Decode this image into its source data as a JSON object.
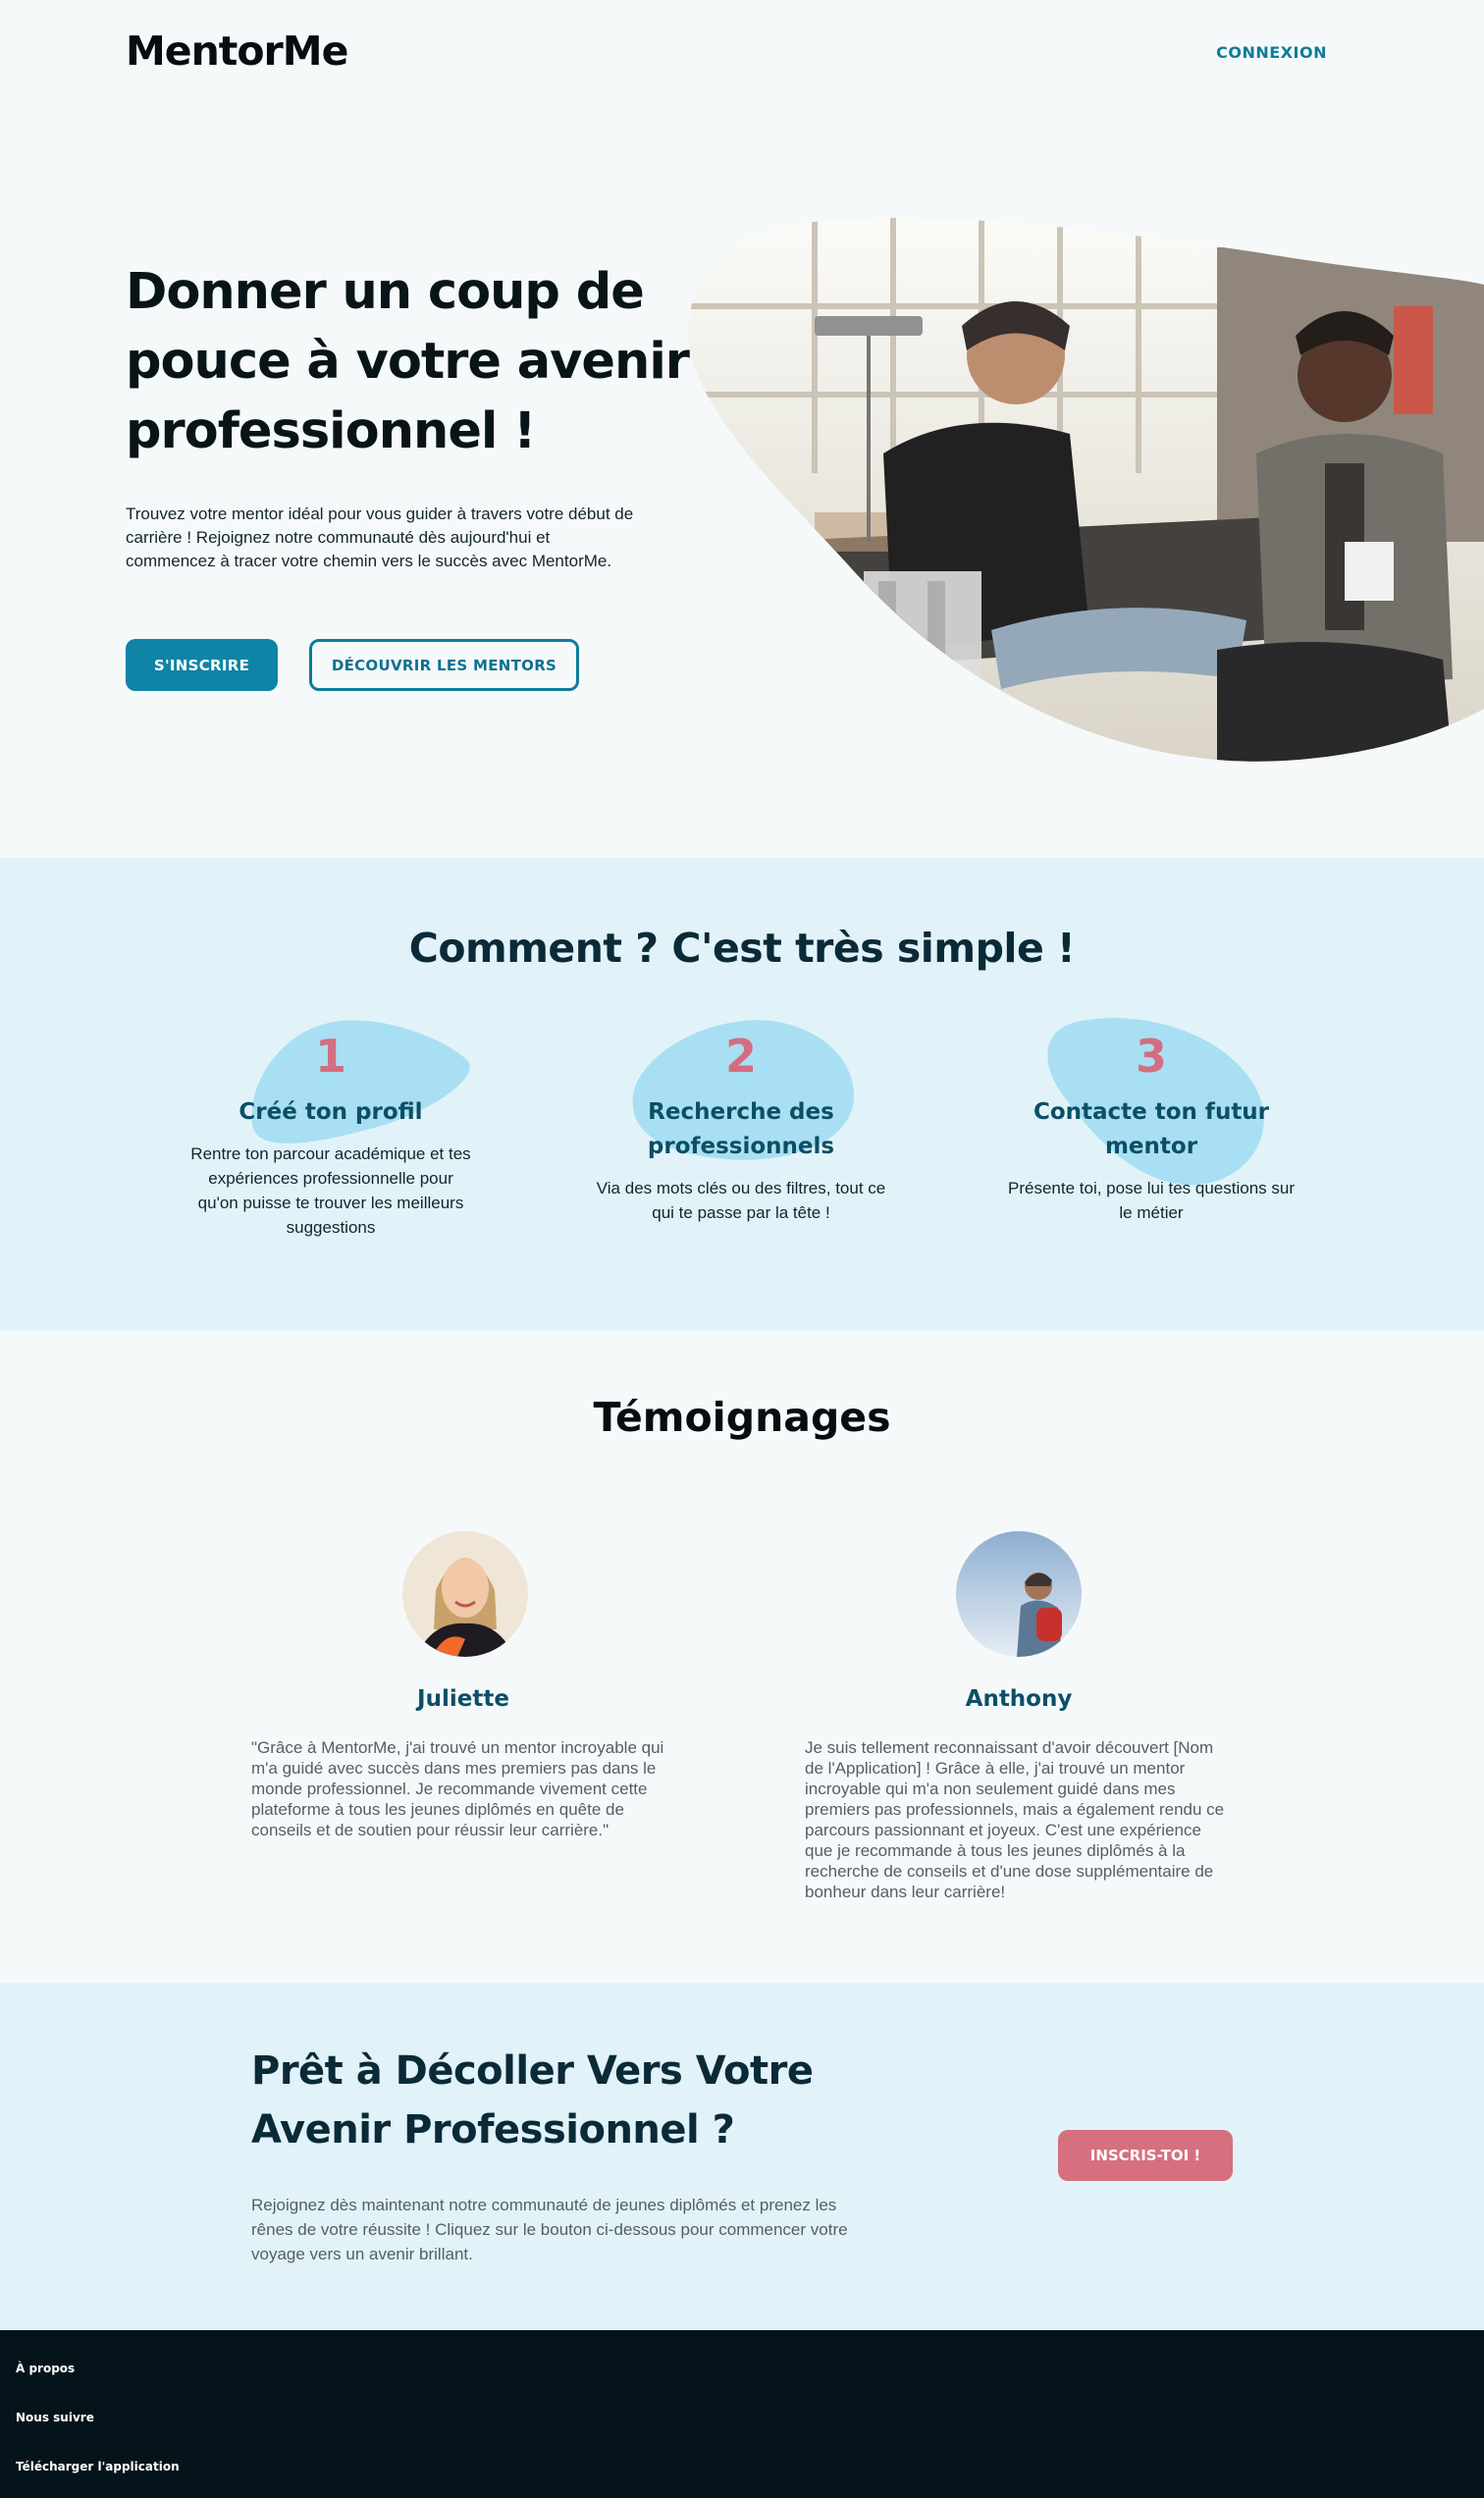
{
  "header": {
    "logo": "MentorMe",
    "login_label": "CONNEXION"
  },
  "hero": {
    "title": "Donner un coup de pouce à votre avenir professionnel !",
    "text": "Trouvez votre mentor idéal pour vous guider à travers votre début de carrière ! Rejoignez notre communauté dès aujourd'hui et commencez à tracer votre chemin vers le succès avec MentorMe.",
    "signup_label": "S'INSCRIRE",
    "mentors_label": "DÉCOUVRIR LES MENTORS"
  },
  "how": {
    "title": "Comment ? C'est très simple !",
    "steps": [
      {
        "number": "1",
        "title": "Créé ton profil",
        "text": "Rentre ton parcour académique et tes expériences professionnelle pour qu'on puisse te trouver les meilleurs suggestions"
      },
      {
        "number": "2",
        "title": "Recherche des professionnels",
        "text": "Via des mots clés ou des filtres, tout ce qui te passe par la tête !"
      },
      {
        "number": "3",
        "title": "Contacte ton futur mentor",
        "text": "Présente toi, pose lui tes questions sur le métier"
      }
    ]
  },
  "testimonials": {
    "title": "Témoignages",
    "items": [
      {
        "name": "Juliette",
        "text": "\"Grâce à MentorMe, j'ai trouvé un mentor incroyable qui m'a guidé avec succès dans mes premiers pas dans le monde professionnel. Je recommande vivement cette plateforme à tous les jeunes diplômés en quête de conseils et de soutien pour réussir leur carrière.\""
      },
      {
        "name": "Anthony",
        "text": "Je suis tellement reconnaissant d'avoir découvert [Nom de l'Application] ! Grâce à elle, j'ai trouvé un mentor incroyable qui m'a non seulement guidé dans mes premiers pas professionnels, mais a également rendu ce parcours passionnant et joyeux. C'est une expérience que je recommande à tous les jeunes diplômés à la recherche de conseils et d'une dose supplémentaire de bonheur dans leur carrière!"
      }
    ]
  },
  "cta": {
    "title": "Prêt à Décoller Vers Votre Avenir Professionnel ?",
    "text": "Rejoignez dès maintenant notre communauté de jeunes diplômés et prenez les rênes de votre réussite ! Cliquez sur le bouton ci-dessous pour commencer votre voyage vers un avenir brillant.",
    "button_label": "INSCRIS-TOI !"
  },
  "footer": {
    "links": [
      "À propos",
      "Nous suivre",
      "Télécharger l'application"
    ]
  },
  "colors": {
    "primary": "#0f84a6",
    "accent_pink": "#d6707f",
    "section_bg": "#e1f3f9",
    "footer_bg": "#05141b"
  }
}
